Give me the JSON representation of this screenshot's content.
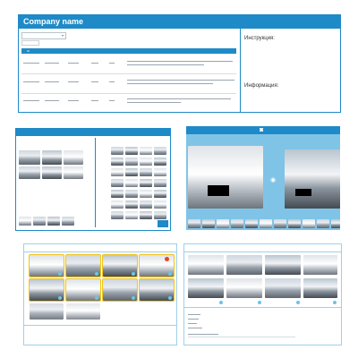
{
  "panel1": {
    "header_title": "Company name",
    "filter_value": "",
    "columns": [
      "ID",
      "",
      "",
      "",
      "",
      ""
    ],
    "rows": [
      {
        "cells": [
          "",
          "",
          "",
          "",
          "",
          ""
        ]
      },
      {
        "cells": [
          "",
          "",
          "",
          "",
          "",
          ""
        ]
      },
      {
        "cells": [
          "",
          "",
          "",
          "",
          "",
          ""
        ]
      }
    ],
    "side_top_title": "Инструкция:",
    "side_bottom_title": "Информация:"
  },
  "panel2": {
    "header_title": "",
    "left_section_label": "",
    "right_section_label": ""
  },
  "panel3": {
    "header_title": ""
  },
  "panel4": {
    "header_label": "",
    "bottom_labels": [
      "",
      "",
      ""
    ]
  },
  "panel5": {
    "header_label": "",
    "fields": [
      "",
      "",
      "",
      "",
      ""
    ]
  },
  "colors": {
    "accent": "#1e8ac7",
    "light_accent": "#6cc3ea",
    "selected_highlight": "#f0c419",
    "marker_red": "#e2452b"
  }
}
